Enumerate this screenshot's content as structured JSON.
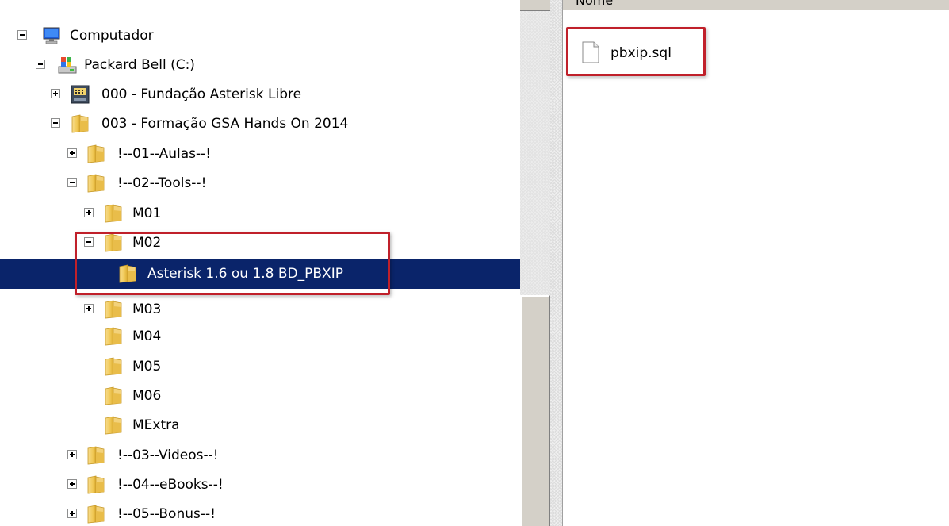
{
  "tree": {
    "computer": "Computador",
    "drive": "Packard Bell (C:)",
    "folders": {
      "f000": "000 - Fundação Asterisk Libre",
      "f003": "003 - Formação GSA Hands On 2014",
      "aulas": "!--01--Aulas--!",
      "tools": "!--02--Tools--!",
      "m01": "M01",
      "m02": "M02",
      "asterisk": "Asterisk 1.6 ou 1.8 BD_PBXIP",
      "m03": "M03",
      "m04": "M04",
      "m05": "M05",
      "m06": "M06",
      "mextra": "MExtra",
      "videos": "!--03--Videos--!",
      "ebooks": "!--04--eBooks--!",
      "bonus": "!--05--Bonus--!"
    }
  },
  "list": {
    "column_header": "Nome",
    "files": [
      "pbxip.sql"
    ]
  },
  "colors": {
    "selection": "#0a246a",
    "highlight_box": "#c0202a"
  }
}
